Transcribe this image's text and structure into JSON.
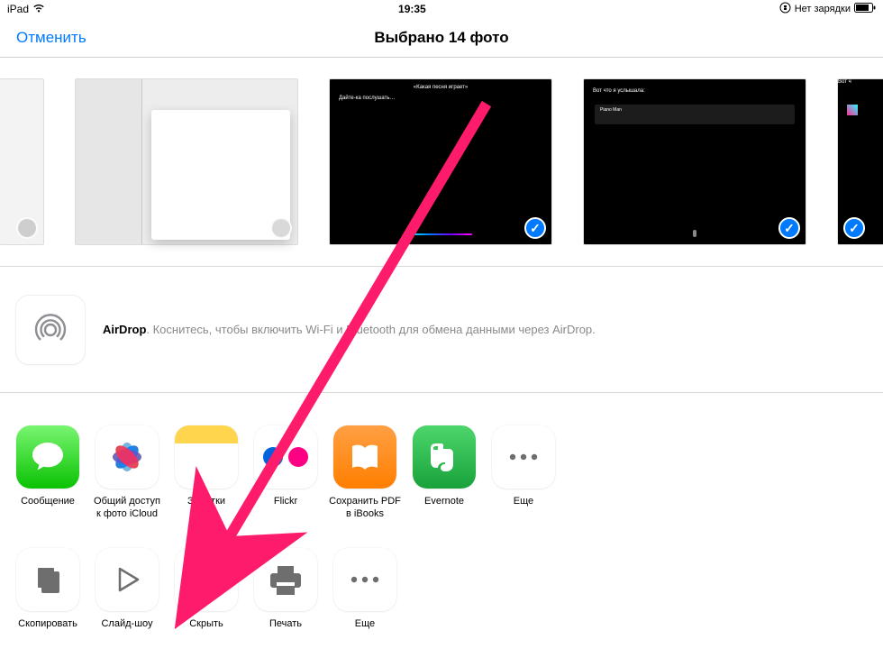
{
  "status": {
    "device": "iPad",
    "time": "19:35",
    "battery": "Нет зарядки"
  },
  "nav": {
    "cancel": "Отменить",
    "title": "Выбрано 14 фото"
  },
  "thumbnails": [
    {
      "kind": "partial",
      "selected": false
    },
    {
      "kind": "settings",
      "selected": false
    },
    {
      "kind": "siri-play",
      "title": "Дайте-ка послушать…",
      "top": "«Какая песня играет»",
      "selected": true
    },
    {
      "kind": "siri-result",
      "title": "Вот что я услышала:",
      "track": "Piano Man",
      "selected": true
    },
    {
      "kind": "partial-right",
      "title": "Вот ч",
      "selected": true
    }
  ],
  "airdrop": {
    "bold": "AirDrop",
    "text": ". Коснитесь, чтобы включить Wi-Fi и Bluetooth для обмена данными через AirDrop."
  },
  "apps": [
    {
      "label": "Сообщение",
      "key": "messages"
    },
    {
      "label": "Общий доступ к фото iCloud",
      "key": "photos"
    },
    {
      "label": "Заметки",
      "key": "notes"
    },
    {
      "label": "Flickr",
      "key": "flickr"
    },
    {
      "label": "Сохранить PDF в iBooks",
      "key": "ibooks"
    },
    {
      "label": "Evernote",
      "key": "evernote"
    },
    {
      "label": "Еще",
      "key": "more"
    }
  ],
  "actions": [
    {
      "label": "Скопировать",
      "key": "copy"
    },
    {
      "label": "Слайд-шоу",
      "key": "slideshow"
    },
    {
      "label": "Скрыть",
      "key": "hide"
    },
    {
      "label": "Печать",
      "key": "print"
    },
    {
      "label": "Еще",
      "key": "more"
    }
  ]
}
